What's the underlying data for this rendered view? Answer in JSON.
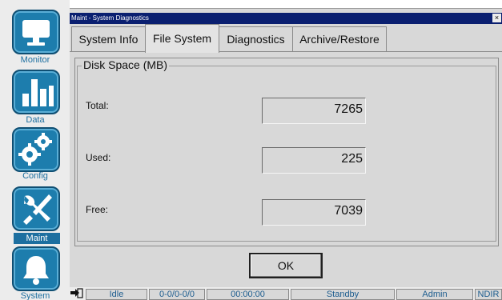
{
  "sidebar": {
    "items": [
      {
        "label": "Monitor",
        "icon": "monitor-icon",
        "active": false
      },
      {
        "label": "Data",
        "icon": "bar-chart-icon",
        "active": false
      },
      {
        "label": "Config",
        "icon": "gears-icon",
        "active": false
      },
      {
        "label": "Maint",
        "icon": "tools-icon",
        "active": true
      },
      {
        "label": "System",
        "icon": "bell-icon",
        "active": false
      }
    ]
  },
  "dialog": {
    "title": "Maint - System Diagnostics",
    "close_label": "×",
    "tabs": [
      {
        "label": "System Info",
        "active": false
      },
      {
        "label": "File System",
        "active": true
      },
      {
        "label": "Diagnostics",
        "active": false
      },
      {
        "label": "Archive/Restore",
        "active": false
      }
    ],
    "group_title": "Disk Space (MB)",
    "fields": [
      {
        "label": "Total:",
        "value": "7265"
      },
      {
        "label": "Used:",
        "value": "225"
      },
      {
        "label": "Free:",
        "value": "7039"
      }
    ],
    "ok_label": "OK"
  },
  "statusbar": {
    "cells": [
      "Idle",
      "0-0/0-0/0",
      "00:00:00",
      "Standby",
      "Admin",
      "NDIR"
    ]
  },
  "colors": {
    "accent": "#1d7dad",
    "titlebar": "#0a1f70",
    "status_text": "#1d5d8f"
  }
}
